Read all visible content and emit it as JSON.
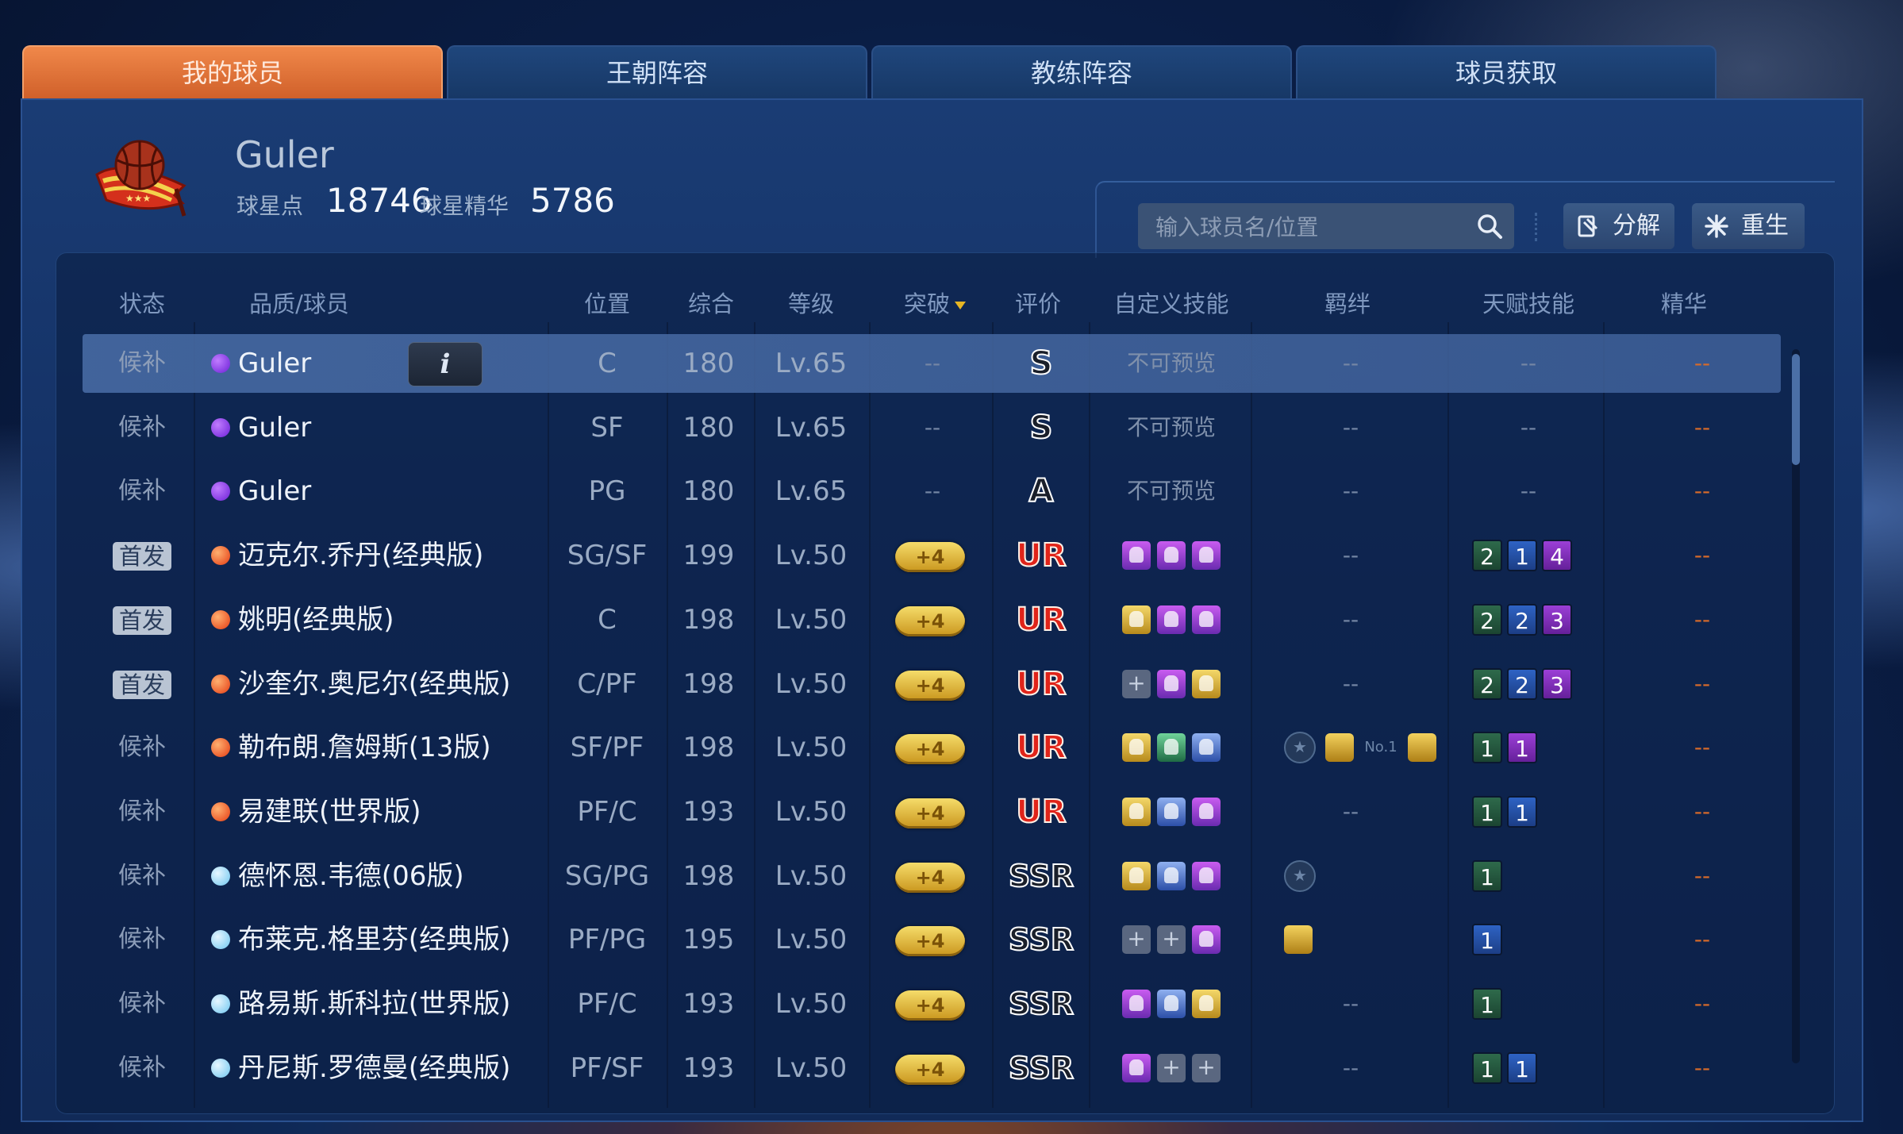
{
  "tabs": [
    {
      "label": "我的球员",
      "active": true
    },
    {
      "label": "王朝阵容",
      "active": false
    },
    {
      "label": "教练阵容",
      "active": false
    },
    {
      "label": "球员获取",
      "active": false
    }
  ],
  "header": {
    "name": "Guler",
    "points_label": "球星点",
    "points_value": "18746",
    "essence_label": "球星精华",
    "essence_value": "5786"
  },
  "search": {
    "placeholder": "输入球员名/位置"
  },
  "actions": {
    "decompose": "分解",
    "reborn": "重生"
  },
  "columns": {
    "status": "状态",
    "player": "品质/球员",
    "position": "位置",
    "overall": "综合",
    "level": "等级",
    "breakthrough": "突破",
    "rating": "评价",
    "custom_skills": "自定义技能",
    "bonds": "羁绊",
    "talents": "天赋技能",
    "essence": "精华"
  },
  "info_button": "i",
  "rows": [
    {
      "status": "候补",
      "starter": false,
      "quality": "purple",
      "name": "Guler",
      "pos": "C",
      "ovr": "180",
      "lvl": "Lv.65",
      "breakthrough": "--",
      "rating": "S",
      "skills_text": "不可预览",
      "skills": [],
      "bonds_text": "--",
      "bonds": [],
      "talents_text": "--",
      "talents": [],
      "essence": "--"
    },
    {
      "status": "候补",
      "starter": false,
      "quality": "purple",
      "name": "Guler",
      "pos": "SF",
      "ovr": "180",
      "lvl": "Lv.65",
      "breakthrough": "--",
      "rating": "S",
      "skills_text": "不可预览",
      "skills": [],
      "bonds_text": "--",
      "bonds": [],
      "talents_text": "--",
      "talents": [],
      "essence": "--"
    },
    {
      "status": "候补",
      "starter": false,
      "quality": "purple",
      "name": "Guler",
      "pos": "PG",
      "ovr": "180",
      "lvl": "Lv.65",
      "breakthrough": "--",
      "rating": "A",
      "skills_text": "不可预览",
      "skills": [],
      "bonds_text": "--",
      "bonds": [],
      "talents_text": "--",
      "talents": [],
      "essence": "--"
    },
    {
      "status": "首发",
      "starter": true,
      "quality": "red",
      "name": "迈克尔.乔丹(经典版)",
      "pos": "SG/SF",
      "ovr": "199",
      "lvl": "Lv.50",
      "breakthrough": "+4",
      "rating": "UR",
      "skills_text": "",
      "skills": [
        "pu",
        "pu",
        "pu"
      ],
      "bonds_text": "--",
      "bonds": [],
      "talents_text": "",
      "talents": [
        {
          "v": "2",
          "c": "green"
        },
        {
          "v": "1",
          "c": "blue"
        },
        {
          "v": "4",
          "c": "purple"
        }
      ],
      "essence": "--"
    },
    {
      "status": "首发",
      "starter": true,
      "quality": "red",
      "name": "姚明(经典版)",
      "pos": "C",
      "ovr": "198",
      "lvl": "Lv.50",
      "breakthrough": "+4",
      "rating": "UR",
      "skills_text": "",
      "skills": [
        "go",
        "pu",
        "pu"
      ],
      "bonds_text": "--",
      "bonds": [],
      "talents_text": "",
      "talents": [
        {
          "v": "2",
          "c": "green"
        },
        {
          "v": "2",
          "c": "blue"
        },
        {
          "v": "3",
          "c": "purple"
        }
      ],
      "essence": "--"
    },
    {
      "status": "首发",
      "starter": true,
      "quality": "red",
      "name": "沙奎尔.奥尼尔(经典版)",
      "pos": "C/PF",
      "ovr": "198",
      "lvl": "Lv.50",
      "breakthrough": "+4",
      "rating": "UR",
      "skills_text": "",
      "skills": [
        "empty",
        "pu",
        "go"
      ],
      "bonds_text": "--",
      "bonds": [],
      "talents_text": "",
      "talents": [
        {
          "v": "2",
          "c": "green"
        },
        {
          "v": "2",
          "c": "blue"
        },
        {
          "v": "3",
          "c": "purple"
        }
      ],
      "essence": "--"
    },
    {
      "status": "候补",
      "starter": false,
      "quality": "red",
      "name": "勒布朗.詹姆斯(13版)",
      "pos": "SF/PF",
      "ovr": "198",
      "lvl": "Lv.50",
      "breakthrough": "+4",
      "rating": "UR",
      "skills_text": "",
      "skills": [
        "go",
        "gr",
        "bl"
      ],
      "bonds_text": "",
      "bonds": [
        "star",
        "gold",
        "no1",
        "gold"
      ],
      "talents_text": "",
      "talents": [
        {
          "v": "1",
          "c": "green"
        },
        {
          "v": "1",
          "c": "purple"
        }
      ],
      "essence": "--"
    },
    {
      "status": "候补",
      "starter": false,
      "quality": "red",
      "name": "易建联(世界版)",
      "pos": "PF/C",
      "ovr": "193",
      "lvl": "Lv.50",
      "breakthrough": "+4",
      "rating": "UR",
      "skills_text": "",
      "skills": [
        "go",
        "bl",
        "pu"
      ],
      "bonds_text": "--",
      "bonds": [],
      "talents_text": "",
      "talents": [
        {
          "v": "1",
          "c": "green"
        },
        {
          "v": "1",
          "c": "blue"
        }
      ],
      "essence": "--"
    },
    {
      "status": "候补",
      "starter": false,
      "quality": "blue",
      "name": "德怀恩.韦德(06版)",
      "pos": "SG/PG",
      "ovr": "198",
      "lvl": "Lv.50",
      "breakthrough": "+4",
      "rating": "SSR",
      "skills_text": "",
      "skills": [
        "go",
        "bl",
        "pu"
      ],
      "bonds_text": "",
      "bonds": [
        "star"
      ],
      "talents_text": "",
      "talents": [
        {
          "v": "1",
          "c": "green"
        }
      ],
      "essence": "--"
    },
    {
      "status": "候补",
      "starter": false,
      "quality": "blue",
      "name": "布莱克.格里芬(经典版)",
      "pos": "PF/PG",
      "ovr": "195",
      "lvl": "Lv.50",
      "breakthrough": "+4",
      "rating": "SSR",
      "skills_text": "",
      "skills": [
        "empty",
        "empty",
        "pu"
      ],
      "bonds_text": "",
      "bonds": [
        "gold"
      ],
      "talents_text": "",
      "talents": [
        {
          "v": "1",
          "c": "blue"
        }
      ],
      "essence": "--"
    },
    {
      "status": "候补",
      "starter": false,
      "quality": "blue",
      "name": "路易斯.斯科拉(世界版)",
      "pos": "PF/C",
      "ovr": "193",
      "lvl": "Lv.50",
      "breakthrough": "+4",
      "rating": "SSR",
      "skills_text": "",
      "skills": [
        "pu",
        "bl",
        "go"
      ],
      "bonds_text": "--",
      "bonds": [],
      "talents_text": "",
      "talents": [
        {
          "v": "1",
          "c": "green"
        }
      ],
      "essence": "--"
    },
    {
      "status": "候补",
      "starter": false,
      "quality": "blue",
      "name": "丹尼斯.罗德曼(经典版)",
      "pos": "PF/SF",
      "ovr": "193",
      "lvl": "Lv.50",
      "breakthrough": "+4",
      "rating": "SSR",
      "skills_text": "",
      "skills": [
        "pu",
        "empty",
        "empty"
      ],
      "bonds_text": "--",
      "bonds": [],
      "talents_text": "",
      "talents": [
        {
          "v": "1",
          "c": "green"
        },
        {
          "v": "1",
          "c": "blue"
        }
      ],
      "essence": "--"
    }
  ]
}
